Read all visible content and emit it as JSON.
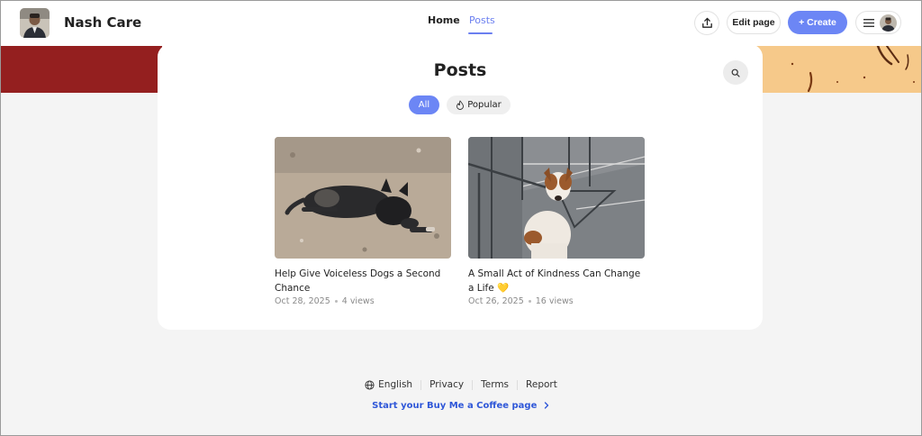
{
  "header": {
    "brand": "Nash Care",
    "nav": [
      {
        "label": "Home",
        "active": false
      },
      {
        "label": "Posts",
        "active": true
      }
    ],
    "edit_label": "Edit page",
    "create_label": "+ Create",
    "share_icon": "share-upload-icon",
    "menu_icon": "hamburger-menu-icon",
    "accent": "#6c86f5"
  },
  "cover": {
    "left_color": "#941f1f",
    "right_color": "#f6c98a"
  },
  "posts_section": {
    "title": "Posts",
    "search_icon": "search-icon",
    "filters": [
      {
        "label": "All",
        "active": true
      },
      {
        "label": "Popular",
        "active": false,
        "icon": "flame-icon"
      }
    ],
    "posts": [
      {
        "title": "Help Give Voiceless Dogs a Second Chance",
        "date": "Oct 28, 2025",
        "views": "4 views"
      },
      {
        "title": "A Small Act of Kindness Can Change a Life 💛",
        "date": "Oct 26, 2025",
        "views": "16 views"
      }
    ]
  },
  "footer": {
    "language": "English",
    "privacy": "Privacy",
    "terms": "Terms",
    "report": "Report",
    "cta": "Start your Buy Me a Coffee page",
    "globe_icon": "globe-icon",
    "chevron_icon": "chevron-right-icon"
  }
}
